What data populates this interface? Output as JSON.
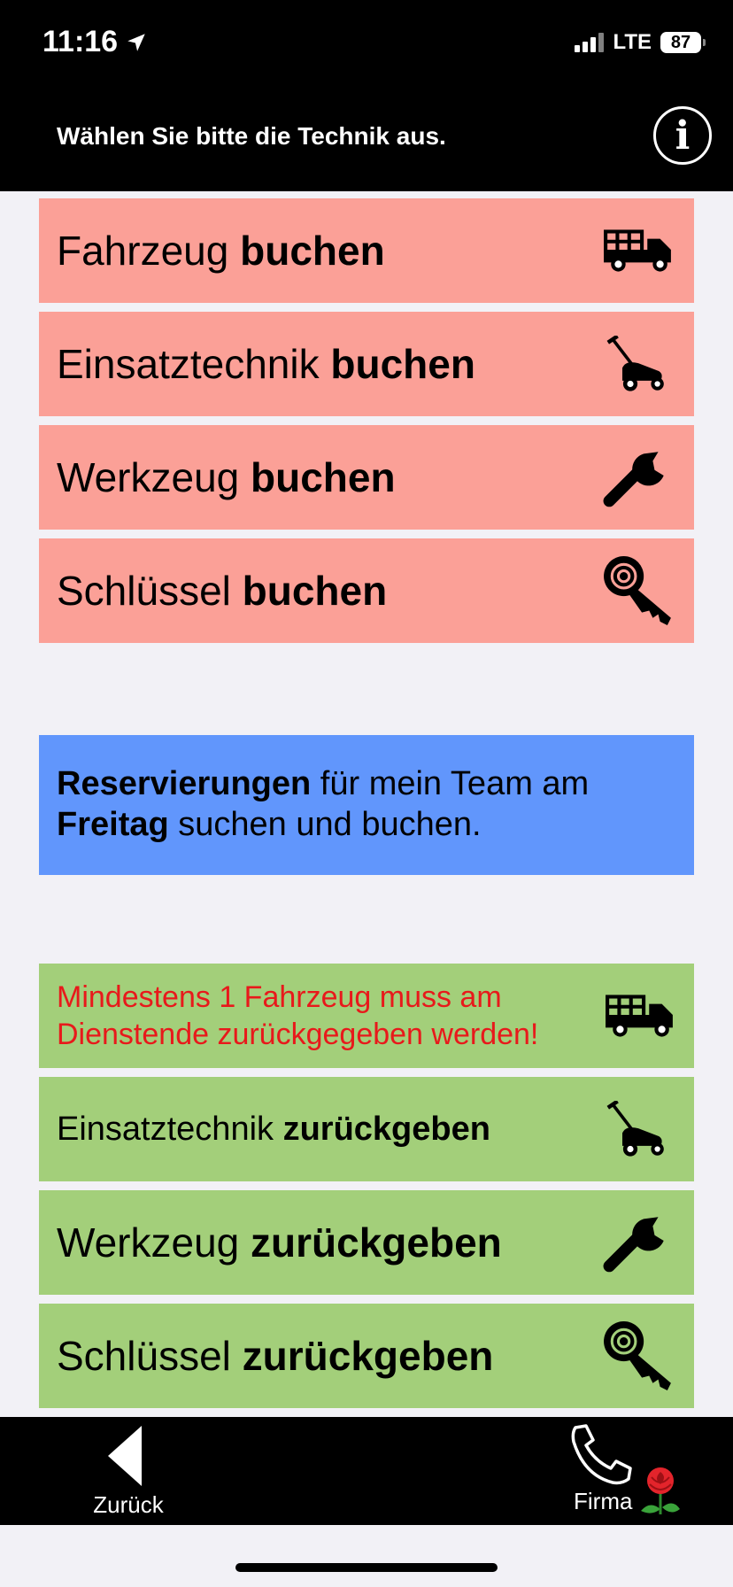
{
  "status": {
    "time": "11:16",
    "network": "LTE",
    "battery": "87"
  },
  "header": {
    "title": "Wählen Sie bitte die Technik aus.",
    "info_icon": "i"
  },
  "book_tiles": [
    {
      "label_normal": "Fahrzeug ",
      "label_bold": "buchen",
      "icon": "truck-icon"
    },
    {
      "label_normal": "Einsatztechnik ",
      "label_bold": "buchen",
      "icon": "lawnmower-icon"
    },
    {
      "label_normal": "Werkzeug ",
      "label_bold": "buchen",
      "icon": "wrench-icon"
    },
    {
      "label_normal": "Schlüssel ",
      "label_bold": "buchen",
      "icon": "key-icon"
    }
  ],
  "reservation": {
    "part1_bold": "Reservierungen",
    "part2": " für mein Team am ",
    "part3_bold": "Freitag",
    "part4": " suchen und buchen."
  },
  "return_tiles": [
    {
      "warning": "Mindestens 1 Fahrzeug muss am Dienstende zurückgegeben werden!",
      "icon": "truck-icon"
    },
    {
      "label_normal": "Einsatztechnik ",
      "label_bold": "zurückgeben",
      "icon": "lawnmower-icon"
    },
    {
      "label_normal": "Werkzeug ",
      "label_bold": "zurückgeben",
      "icon": "wrench-icon"
    },
    {
      "label_normal": "Schlüssel ",
      "label_bold": "zurückgeben",
      "icon": "key-icon"
    }
  ],
  "colors": {
    "book": "#fba097",
    "return": "#a3cf7a",
    "reservation": "#6196fc",
    "warning": "#e8191b"
  },
  "footer": {
    "back_label": "Zurück",
    "company_label": "Firma"
  }
}
